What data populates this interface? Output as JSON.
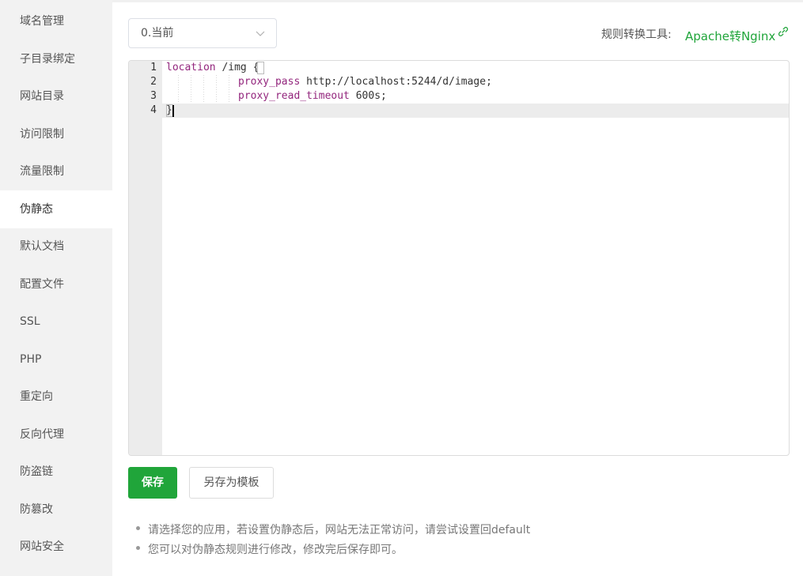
{
  "sidebar": {
    "items": [
      {
        "label": "域名管理"
      },
      {
        "label": "子目录绑定"
      },
      {
        "label": "网站目录"
      },
      {
        "label": "访问限制"
      },
      {
        "label": "流量限制"
      },
      {
        "label": "伪静态"
      },
      {
        "label": "默认文档"
      },
      {
        "label": "配置文件"
      },
      {
        "label": "SSL"
      },
      {
        "label": "PHP"
      },
      {
        "label": "重定向"
      },
      {
        "label": "反向代理"
      },
      {
        "label": "防盗链"
      },
      {
        "label": "防篡改"
      },
      {
        "label": "网站安全"
      }
    ],
    "active_index": 5
  },
  "rule_select": {
    "value": "0.当前"
  },
  "tool": {
    "label": "规则转换工具:",
    "link_text": "Apache转Nginx",
    "link_icon": "link-icon"
  },
  "editor": {
    "line_numbers": [
      "1",
      "2",
      "3",
      "4"
    ],
    "lines": [
      {
        "kw": "location",
        "rest": " /img {"
      },
      {
        "kw": "proxy_pass",
        "rest": " http://localhost:5244/d/image;"
      },
      {
        "kw": "proxy_read_timeout",
        "rest": " 600s;"
      },
      {
        "kw": "",
        "rest": "}"
      }
    ],
    "active_line": 4
  },
  "buttons": {
    "save_label": "保存",
    "save_as_template_label": "另存为模板"
  },
  "tips": [
    "请选择您的应用，若设置伪静态后，网站无法正常访问，请尝试设置回default",
    "您可以对伪静态规则进行修改，修改完后保存即可。"
  ],
  "colors": {
    "accent": "#20a53a",
    "keyword": "#93267d",
    "sidebar_bg": "#f2f2f2"
  }
}
